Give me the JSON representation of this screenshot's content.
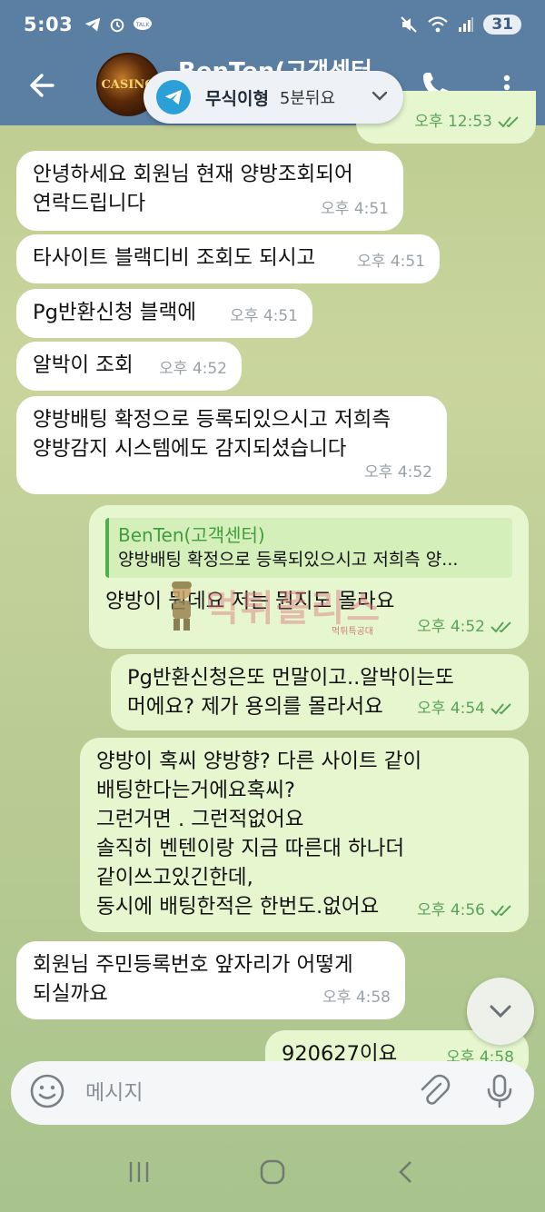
{
  "status_bar": {
    "time": "5:03",
    "battery": "31"
  },
  "header": {
    "title": "BenTen(고객센터",
    "avatar_text": "CASINO",
    "dnd_label": "무식이형",
    "dnd_sub": "5분뒤요"
  },
  "partial_top": {
    "time": "오후 12:53"
  },
  "messages": [
    {
      "dir": "in",
      "text": "안녕하세요 회원님 현재 양방조회되어\n연락드립니다",
      "time": "오후 4:51"
    },
    {
      "dir": "in",
      "text": "타사이트 블랙디비 조회도 되시고",
      "time": "오후 4:51"
    },
    {
      "dir": "in",
      "text": "Pg반환신청 블랙에",
      "time": "오후 4:51"
    },
    {
      "dir": "in",
      "text": "알박이 조회",
      "time": "오후 4:52"
    },
    {
      "dir": "in",
      "text": "양방배팅 확정으로 등록되있으시고 저희측\n양방감지 시스템에도 감지되셨습니다",
      "time": "오후 4:52"
    },
    {
      "dir": "out",
      "quote_name": "BenTen(고객센터)",
      "quote_text": "양방배팅 확정으로 등록되있으시고 저희측 양...",
      "text": "양방이 뭔데요 저는 뭔지도 몰라요",
      "time": "오후 4:52"
    },
    {
      "dir": "out",
      "text": "Pg반환신청은또 먼말이고..알박이는또\n머에요? 제가 용의를 몰라서요",
      "time": "오후 4:54"
    },
    {
      "dir": "out",
      "text": "양방이 혹씨 양방향? 다른 사이트 같이\n배팅한다는거에요혹씨?\n그런거면 . 그런적없어요\n솔직히 벤텐이랑 지금 따른대 하나더\n같이쓰고있긴한데,\n동시에 배팅한적은 한번도.없어요",
      "time": "오후 4:56"
    },
    {
      "dir": "in",
      "text": "회원님 주민등록번호 앞자리가 어떻게\n되실까요",
      "time": "오후 4:58"
    },
    {
      "dir": "out",
      "text": "920627이요",
      "time": "오후 4:58"
    }
  ],
  "watermark": {
    "text": "먹튀폴리스",
    "sub": "먹튀특공대"
  },
  "composer": {
    "placeholder": "메시지"
  },
  "icons": {
    "back": "back-arrow-icon",
    "call": "phone-icon",
    "menu": "more-vert-icon",
    "telegram": "telegram-icon",
    "emoji": "emoji-icon",
    "attach": "paperclip-icon",
    "mic": "microphone-icon"
  },
  "colors": {
    "app_bar": "#5a7fa3",
    "incoming": "#ffffff",
    "outgoing": "#e6f7cf",
    "accent_green": "#4fae4e"
  }
}
